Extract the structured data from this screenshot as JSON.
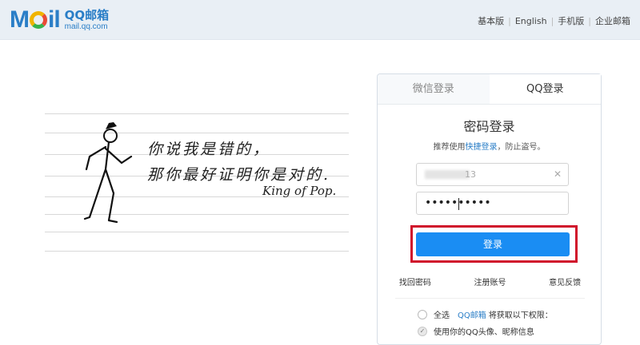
{
  "header": {
    "logo_main": "Mail",
    "logo_cn": "QQ邮箱",
    "logo_url": "mail.qq.com",
    "links": [
      "基本版",
      "English",
      "手机版",
      "企业邮箱"
    ]
  },
  "illustration": {
    "quote_line1": "你说我是错的，",
    "quote_line2": "那你最好证明你是对的.",
    "signature": "King of Pop."
  },
  "login_panel": {
    "tabs": [
      {
        "label": "微信登录",
        "active": false
      },
      {
        "label": "QQ登录",
        "active": true
      }
    ],
    "title": "密码登录",
    "subtitle_prefix": "推荐使用",
    "subtitle_link": "快捷登录",
    "subtitle_suffix": "，防止盗号。",
    "username_value": "13",
    "password_value": "••••••••••",
    "login_button": "登录",
    "links": [
      "找回密码",
      "注册账号",
      "意见反馈"
    ],
    "permissions": {
      "select_all": "全选",
      "app_name": "QQ邮箱",
      "grant_text": "将获取以下权限：",
      "item1": "使用你的QQ头像、昵称信息"
    }
  },
  "colors": {
    "accent": "#1a8df3",
    "highlight": "#d0112b",
    "brand": "#2a7ec7"
  }
}
